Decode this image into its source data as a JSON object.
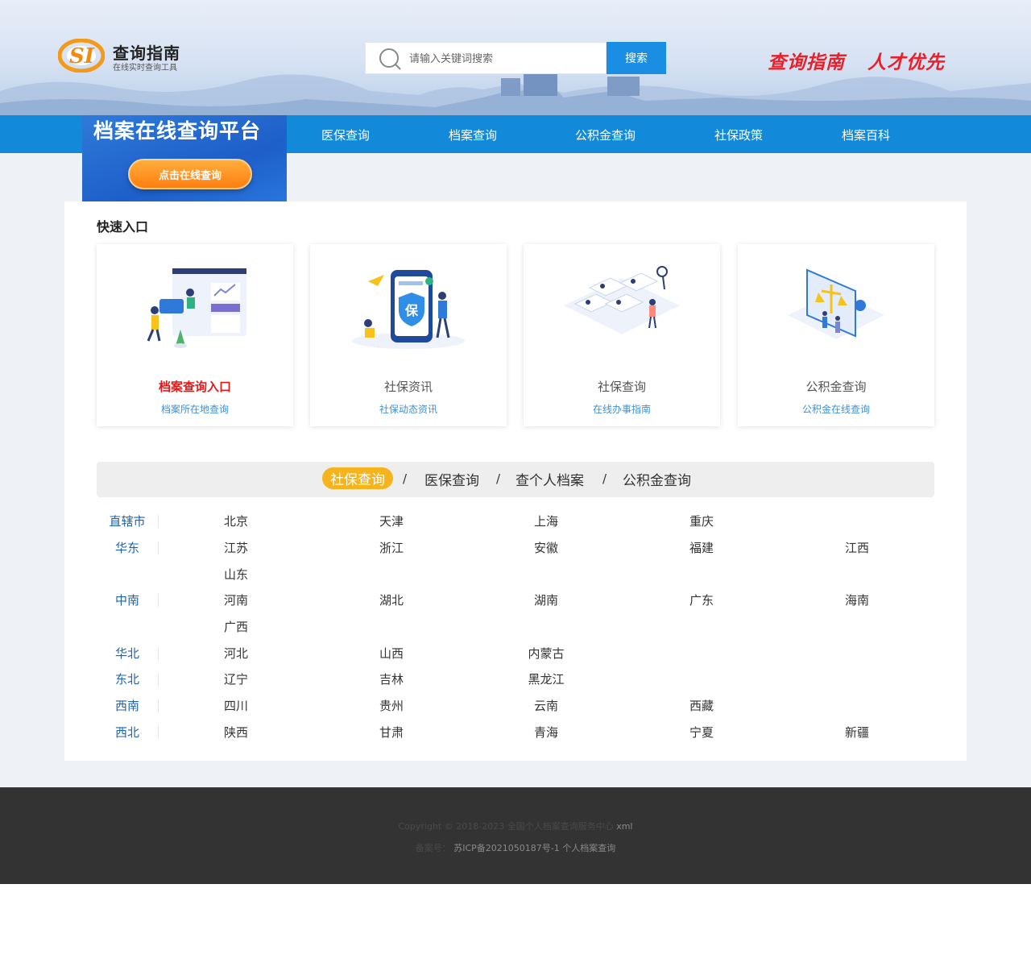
{
  "brand": {
    "title": "查询指南",
    "subtitle": "在线实时查询工具"
  },
  "search": {
    "placeholder": "请输入关键词搜索",
    "button": "搜索"
  },
  "slogans": [
    "查询指南",
    "人才优先"
  ],
  "nav": {
    "items": [
      "医保查询",
      "档案查询",
      "公积金查询",
      "社保政策",
      "档案百科"
    ]
  },
  "banner": {
    "title": "档案在线查询平台",
    "button": "点击在线查询"
  },
  "quick": {
    "title": "快速入口",
    "cards": [
      {
        "title": "档案查询入口",
        "subtitle": "档案所在地查询",
        "highlight": true,
        "icon": "office-worker-illustration-icon"
      },
      {
        "title": "社保资讯",
        "subtitle": "社保动态资讯",
        "highlight": false,
        "icon": "insurance-phone-illustration-icon"
      },
      {
        "title": "社保查询",
        "subtitle": "在线办事指南",
        "highlight": false,
        "icon": "profile-search-illustration-icon"
      },
      {
        "title": "公积金查询",
        "subtitle": "公积金在线查询",
        "highlight": false,
        "icon": "justice-scale-illustration-icon"
      }
    ]
  },
  "tabs": {
    "items": [
      "社保查询",
      "医保查询",
      "查个人档案",
      "公积金查询"
    ],
    "active": 0,
    "separator": "/"
  },
  "regions": [
    {
      "name": "直辖市",
      "provinces": [
        "北京",
        "天津",
        "上海",
        "重庆"
      ]
    },
    {
      "name": "华东",
      "provinces": [
        "江苏",
        "浙江",
        "安徽",
        "福建",
        "江西",
        "山东"
      ]
    },
    {
      "name": "中南",
      "provinces": [
        "河南",
        "湖北",
        "湖南",
        "广东",
        "海南",
        "广西"
      ]
    },
    {
      "name": "华北",
      "provinces": [
        "河北",
        "山西",
        "内蒙古"
      ]
    },
    {
      "name": "东北",
      "provinces": [
        "辽宁",
        "吉林",
        "黑龙江"
      ]
    },
    {
      "name": "西南",
      "provinces": [
        "四川",
        "贵州",
        "云南",
        "西藏"
      ]
    },
    {
      "name": "西北",
      "provinces": [
        "陕西",
        "甘肃",
        "青海",
        "宁夏",
        "新疆"
      ]
    }
  ],
  "footer": {
    "copyright": "Copyright © 2018-2023 全国个人档案查询服务中心",
    "xml": "xml",
    "icp_label": "备案号：",
    "icp": "苏ICP备2021050187号-1 个人档案查询"
  },
  "colors": {
    "brand_blue": "#138ad9",
    "accent_orange": "#ff8a1a",
    "highlight_red": "#e31919",
    "tab_active": "#f5b31e",
    "region_blue": "#1b63b0"
  }
}
